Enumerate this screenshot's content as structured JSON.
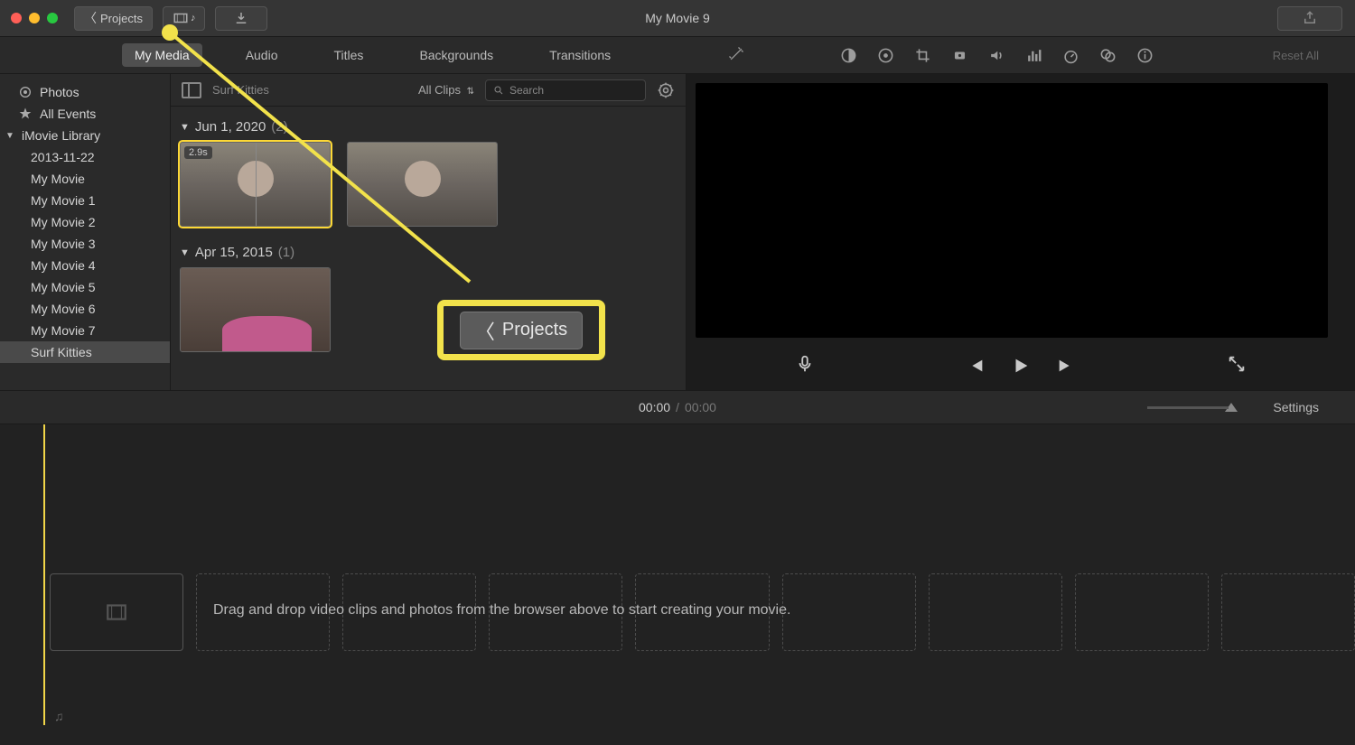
{
  "window": {
    "title": "My Movie 9"
  },
  "toolbar": {
    "projects_label": "Projects",
    "reset_label": "Reset All"
  },
  "tabs": {
    "my_media": "My Media",
    "audio": "Audio",
    "titles": "Titles",
    "backgrounds": "Backgrounds",
    "transitions": "Transitions"
  },
  "sidebar": {
    "photos": "Photos",
    "all_events": "All Events",
    "library": "iMovie Library",
    "items": [
      "2013-11-22",
      "My Movie",
      "My Movie 1",
      "My Movie 2",
      "My Movie 3",
      "My Movie 4",
      "My Movie 5",
      "My Movie 6",
      "My Movie 7",
      "Surf Kitties"
    ]
  },
  "browser": {
    "title": "Surf Kitties",
    "filter": "All Clips",
    "search_placeholder": "Search",
    "groups": [
      {
        "date": "Jun 1, 2020",
        "count": "(2)",
        "clips": [
          {
            "duration": "2.9s"
          },
          {}
        ]
      },
      {
        "date": "Apr 15, 2015",
        "count": "(1)",
        "clips": [
          {}
        ]
      }
    ]
  },
  "timeline": {
    "current": "00:00",
    "sep": "/",
    "total": "00:00",
    "settings": "Settings",
    "hint": "Drag and drop video clips and photos from the browser above to start creating your movie."
  },
  "callout": {
    "label": "Projects"
  }
}
